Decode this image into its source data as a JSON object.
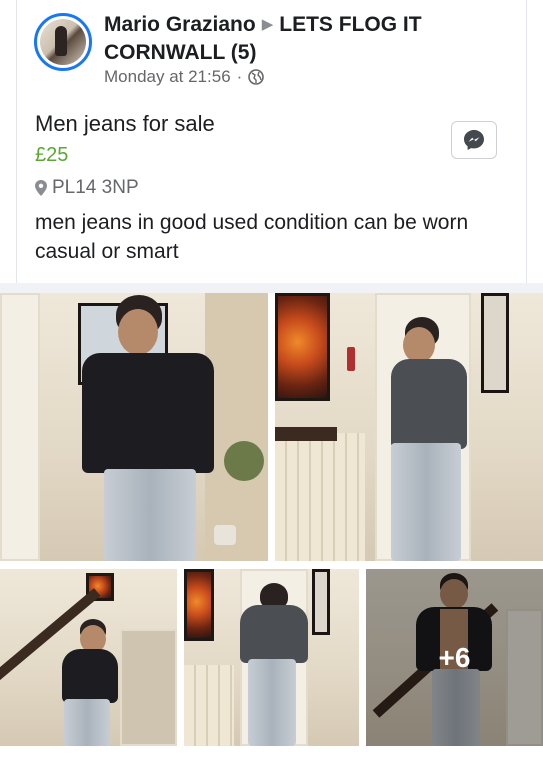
{
  "post": {
    "author": "Mario Graziano",
    "group": "LETS FLOG IT CORNWALL (5)",
    "timestamp": "Monday at 21:56",
    "privacy_icon": "globe-icon"
  },
  "listing": {
    "title": "Men jeans for sale",
    "price": "£25",
    "location": "PL14 3NP",
    "description": "men jeans in good used condition can be worn casual or smart"
  },
  "photos": {
    "more_count": "+6"
  },
  "colors": {
    "accent": "#1877f2",
    "price": "#5aa732",
    "muted": "#65676b"
  }
}
